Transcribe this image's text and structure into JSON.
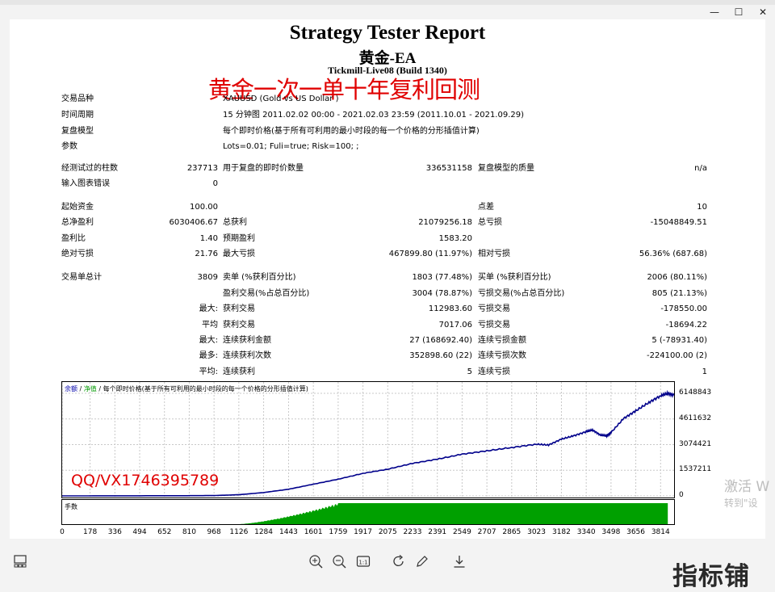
{
  "window": {
    "min_glyph": "—",
    "max_glyph": "☐",
    "close_glyph": "✕"
  },
  "report": {
    "title": "Strategy Tester Report",
    "ea_name": "黄金-EA",
    "server": "Tickmill-Live08 (Build 1340)",
    "overlay_text": "黄金一次一单十年复利回测"
  },
  "info": {
    "symbol": {
      "label": "交易品种",
      "value": "XAUUSD (Gold vs US Dollar )"
    },
    "period": {
      "label": "时间周期",
      "value": "15 分钟图 2011.02.02 00:00 - 2021.02.03 23:59 (2011.10.01 - 2021.09.29)"
    },
    "model": {
      "label": "复盘模型",
      "value": "每个即时价格(基于所有可利用的最小时段的每一个价格的分形插值计算)"
    },
    "params": {
      "label": "参数",
      "value": "Lots=0.01; Fuli=true; Risk=100; ;"
    }
  },
  "bars": {
    "bars_tested": {
      "label": "经测试过的柱数",
      "value": "237713"
    },
    "ticks": {
      "label": "用于复盘的即时价数量",
      "value": "336531158"
    },
    "quality": {
      "label": "复盘模型的质量",
      "value": "n/a"
    },
    "errors": {
      "label": "输入图表错误",
      "value": "0"
    }
  },
  "stats": {
    "deposit": {
      "label": "起始资金",
      "value": "100.00"
    },
    "spread": {
      "label": "点差",
      "value": "10"
    },
    "net_profit": {
      "label": "总净盈利",
      "value": "6030406.67"
    },
    "gross_profit": {
      "label": "总获利",
      "value": "21079256.18"
    },
    "gross_loss": {
      "label": "总亏损",
      "value": "-15048849.51"
    },
    "profit_factor": {
      "label": "盈利比",
      "value": "1.40"
    },
    "expected_payoff": {
      "label": "预期盈利",
      "value": "1583.20"
    },
    "abs_drawdown": {
      "label": "绝对亏损",
      "value": "21.76"
    },
    "max_drawdown": {
      "label": "最大亏损",
      "value": "467899.80 (11.97%)"
    },
    "rel_drawdown": {
      "label": "相对亏损",
      "value": "56.36% (687.68)"
    }
  },
  "trades": {
    "total": {
      "label": "交易单总计",
      "value": "3809"
    },
    "short": {
      "label": "卖单 (%获利百分比)",
      "value": "1803 (77.48%)"
    },
    "long": {
      "label": "买单 (%获利百分比)",
      "value": "2006 (80.11%)"
    },
    "profit_trades": {
      "label": "盈利交易(%占总百分比)",
      "value": "3004 (78.87%)"
    },
    "loss_trades": {
      "label": "亏损交易(%占总百分比)",
      "value": "805 (21.13%)"
    },
    "largest": {
      "label": "最大:",
      "p_label": "获利交易",
      "p_value": "112983.60",
      "l_label": "亏损交易",
      "l_value": "-178550.00"
    },
    "average": {
      "label": "平均",
      "p_label": "获利交易",
      "p_value": "7017.06",
      "l_label": "亏损交易",
      "l_value": "-18694.22"
    },
    "max_consec": {
      "label": "最大:",
      "p_label": "连续获利金额",
      "p_value": "27 (168692.40)",
      "l_label": "连续亏损金额",
      "l_value": "5 (-78931.40)"
    },
    "max_consec_amt": {
      "label": "最多:",
      "p_label": "连续获利次数",
      "p_value": "352898.60 (22)",
      "l_label": "连续亏损次数",
      "l_value": "-224100.00 (2)"
    },
    "avg_consec": {
      "label": "平均:",
      "p_label": "连续获利",
      "p_value": "5",
      "l_label": "连续亏损",
      "l_value": "1"
    }
  },
  "chart_data": {
    "type": "line",
    "legend": [
      "余额",
      "净值",
      "每个即时价格(基于所有可利用的最小时段的每一个价格的分形插值计算)"
    ],
    "legend_sep": "/",
    "y_ticks": [
      "6148843",
      "4611632",
      "3074421",
      "1537211",
      "0"
    ],
    "ylim": [
      0,
      6148843
    ],
    "x_ticks": [
      "0",
      "178",
      "336",
      "494",
      "652",
      "810",
      "968",
      "1126",
      "1284",
      "1443",
      "1601",
      "1759",
      "1917",
      "2075",
      "2233",
      "2391",
      "2549",
      "2707",
      "2865",
      "3023",
      "3182",
      "3340",
      "3498",
      "3656",
      "3814"
    ],
    "xlim": [
      0,
      3900
    ],
    "series": [
      {
        "values": [
          [
            0,
            0
          ],
          [
            400,
            5000
          ],
          [
            800,
            12000
          ],
          [
            968,
            20000
          ],
          [
            1126,
            70000
          ],
          [
            1284,
            200000
          ],
          [
            1443,
            400000
          ],
          [
            1601,
            700000
          ],
          [
            1759,
            1000000
          ],
          [
            1917,
            1350000
          ],
          [
            2075,
            1600000
          ],
          [
            2233,
            1950000
          ],
          [
            2391,
            2200000
          ],
          [
            2549,
            2500000
          ],
          [
            2707,
            2700000
          ],
          [
            2865,
            2900000
          ],
          [
            3023,
            3100000
          ],
          [
            3100,
            3050000
          ],
          [
            3182,
            3400000
          ],
          [
            3260,
            3600000
          ],
          [
            3340,
            3850000
          ],
          [
            3380,
            3950000
          ],
          [
            3430,
            3650000
          ],
          [
            3470,
            3600000
          ],
          [
            3498,
            3800000
          ],
          [
            3580,
            4650000
          ],
          [
            3656,
            5100000
          ],
          [
            3740,
            5600000
          ],
          [
            3814,
            6000000
          ],
          [
            3860,
            6148843
          ],
          [
            3900,
            6030406
          ]
        ]
      }
    ],
    "volume_label": "手数",
    "volume_start": 1126,
    "volume_full": 1759
  },
  "overlays": {
    "qq": "QQ/VX1746395789",
    "watermark_line1": "激活 W",
    "watermark_line2": "转到\"设"
  },
  "brand": "指标铺"
}
